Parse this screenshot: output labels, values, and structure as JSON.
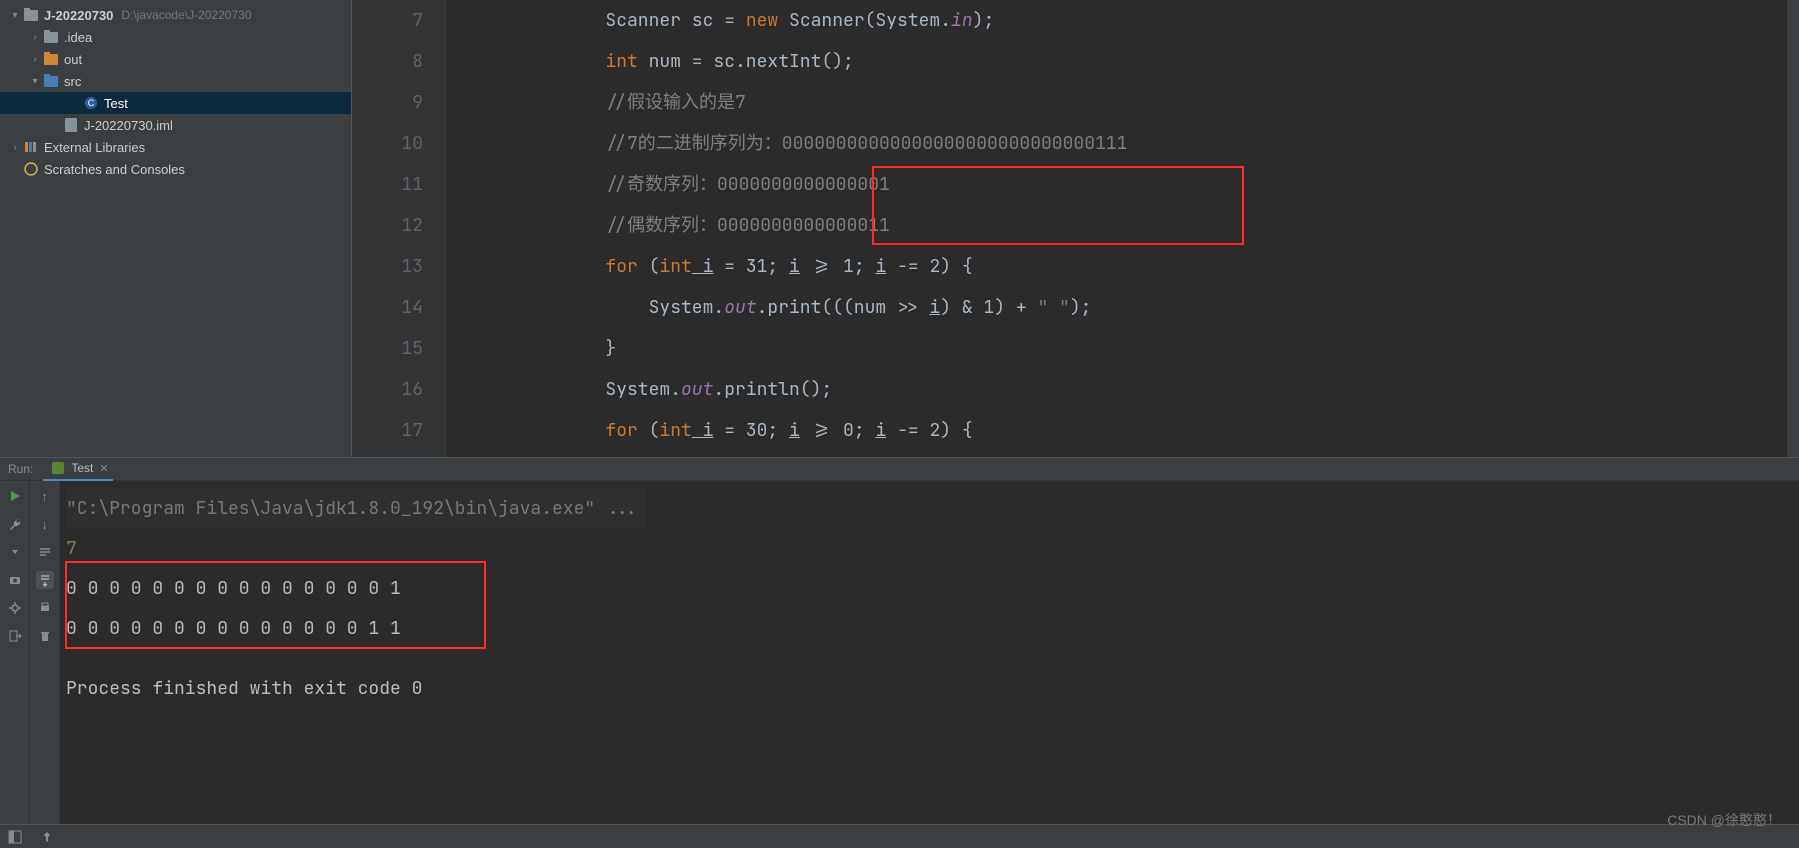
{
  "tree": {
    "root_label": "J-20220730",
    "root_path": "D:\\javacode\\J-20220730",
    "idea": ".idea",
    "out": "out",
    "src": "src",
    "test": "Test",
    "iml": "J-20220730.iml",
    "ext": "External Libraries",
    "scratch": "Scratches and Consoles"
  },
  "gutter": [
    "7",
    "8",
    "9",
    "10",
    "11",
    "12",
    "13",
    "14",
    "15",
    "16",
    "17"
  ],
  "code": {
    "l7": {
      "pre": "        Scanner sc = ",
      "kw": "new",
      "mid": " Scanner(System.",
      "fld": "in",
      "post": ");"
    },
    "l8": {
      "kw": "int",
      "mid": " num = sc.nextInt();"
    },
    "l9": "        //假设输入的是7",
    "l10": "        //7的二进制序列为：00000000000000000000000000000111",
    "l11": "        //奇数序列：0000000000000001",
    "l12": "        //偶数序列：0000000000000011",
    "l13": {
      "kw": "for",
      "mid": " (",
      "kw2": "int",
      "v": " i",
      "rest": " = 31; i >= 1; i -= 2) {"
    },
    "l14": {
      "pre": "            System.",
      "fld": "out",
      "mid": ".print(((num >> ",
      "v": "i",
      "post": ") & 1) + ",
      "str": "\" \"",
      "end": ");"
    },
    "l15": "        }",
    "l16": {
      "pre": "        System.",
      "fld": "out",
      "post": ".println();"
    },
    "l17": {
      "kw": "for",
      "mid": " (",
      "kw2": "int",
      "v": " i",
      "rest": " = 30; i >= 0; i -= 2) {"
    }
  },
  "run": {
    "title": "Run:",
    "tab_label": "Test",
    "cmd": "\"C:\\Program Files\\Java\\jdk1.8.0_192\\bin\\java.exe\" ...",
    "input": "7",
    "out1": "0 0 0 0 0 0 0 0 0 0 0 0 0 0 0 1 ",
    "out2": "0 0 0 0 0 0 0 0 0 0 0 0 0 0 1 1 ",
    "exit": "Process finished with exit code 0"
  },
  "watermark": "CSDN @徐憨憨！"
}
